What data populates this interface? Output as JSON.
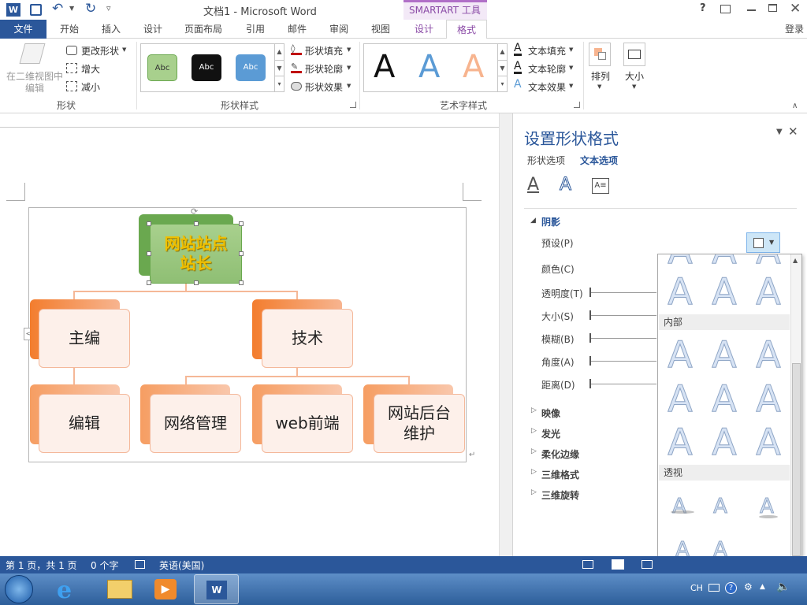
{
  "title": {
    "doc_title": "文档1 - Microsoft Word",
    "context_tab": "SMARTART 工具",
    "help": "?",
    "qat_more": "▿"
  },
  "tabs": [
    "文件",
    "开始",
    "插入",
    "设计",
    "页面布局",
    "引用",
    "邮件",
    "审阅",
    "视图",
    "设计",
    "格式"
  ],
  "login": "登录",
  "ribbon": {
    "shape_group": {
      "edit_2d": "在二维视图中编辑",
      "change_shape": "更改形状",
      "larger": "增大",
      "smaller": "减小",
      "label": "形状"
    },
    "shape_styles": {
      "thumb_label": "Abc",
      "fill": "形状填充",
      "outline": "形状轮廓",
      "effect": "形状效果",
      "label": "形状样式"
    },
    "wordart": {
      "letter": "A",
      "fill": "文本填充",
      "outline": "文本轮廓",
      "effect": "文本效果",
      "label": "艺术字样式"
    },
    "arrange": "排列",
    "size": "大小"
  },
  "smartart": {
    "top": "网站站点站长",
    "left": "主编",
    "right": "技术",
    "b1": "编辑",
    "b2": "网络管理",
    "b3": "web前端",
    "b4": "网站后台维护"
  },
  "panel": {
    "title": "设置形状格式",
    "tab_shape": "形状选项",
    "tab_text": "文本选项",
    "section_shadow": "阴影",
    "preset": "预设(P)",
    "color": "颜色(C)",
    "transparency": "透明度(T)",
    "size": "大小(S)",
    "blur": "模糊(B)",
    "angle": "角度(A)",
    "distance": "距离(D)",
    "reflection": "映像",
    "glow": "发光",
    "soft_edges": "柔化边缘",
    "format_3d": "三维格式",
    "rotation_3d": "三维旋转",
    "dropdown": {
      "inner": "内部",
      "perspective": "透视",
      "letter": "A"
    }
  },
  "status": {
    "page": "第 1 页，共 1 页",
    "words": "0 个字",
    "language": "英语(美国)"
  },
  "taskbar": {
    "ime": "CH"
  },
  "colors": {
    "word_blue": "#2b579a",
    "smartart_purple": "#b06fc7",
    "orange": "#f37d2e",
    "green": "#9ccc84"
  }
}
